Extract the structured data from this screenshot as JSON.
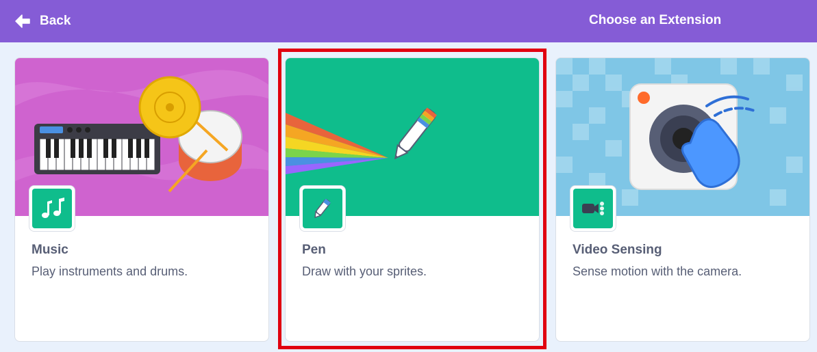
{
  "header": {
    "back_label": "Back",
    "title": "Choose an Extension",
    "back_icon": "arrow-left-icon"
  },
  "colors": {
    "header_bg": "#855cd6",
    "page_bg": "#e9f1fc",
    "icon_bg": "#0fbd8c",
    "text": "#575e75",
    "highlight": "#e00010"
  },
  "extensions": [
    {
      "name": "Music",
      "description": "Play instruments and drums.",
      "icon": "music-notes-icon"
    },
    {
      "name": "Pen",
      "description": "Draw with your sprites.",
      "icon": "pen-icon",
      "highlighted": true
    },
    {
      "name": "Video Sensing",
      "description": "Sense motion with the camera.",
      "icon": "video-camera-icon"
    }
  ]
}
